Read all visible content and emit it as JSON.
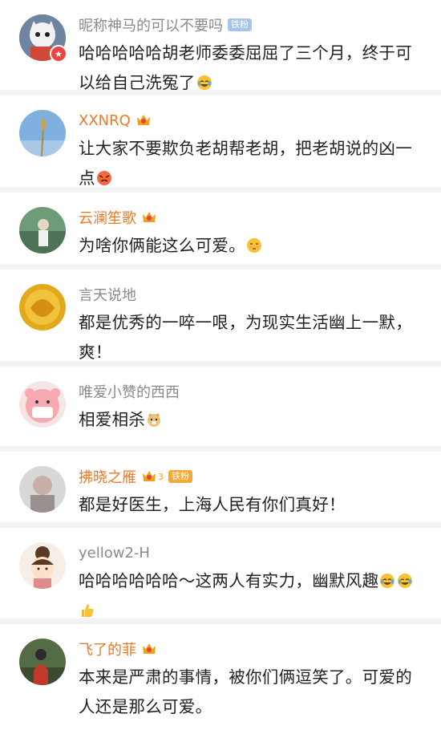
{
  "comments": [
    {
      "name": "昵称神马的可以不要吗",
      "badge": "铁粉",
      "text": "哈哈哈哈哈胡老师委委屈屈了三个月，终于可以给自己洗冤了",
      "emoji_end": "laugh-cry"
    },
    {
      "name": "XXNRQ",
      "text": "让大家不要欺负老胡帮老胡，把老胡说的凶一点",
      "emoji_end": "angry"
    },
    {
      "name": "云澜笙歌",
      "text": "为啥你俩能这么可爱。",
      "emoji_end": "shy"
    },
    {
      "name": "言天说地",
      "text": "都是优秀的一啐一哏，为现实生活幽上一默，爽！"
    },
    {
      "name": "唯爱小赞的西西",
      "text": "相爱相杀",
      "emoji_end": "doge"
    },
    {
      "name": "拂晓之雁",
      "crown_level": "3",
      "badge": "铁粉",
      "text": "都是好医生，上海人民有你们真好！"
    },
    {
      "name": "yellow2-H",
      "text": "哈哈哈哈哈哈～这两人有实力，幽默风趣",
      "emoji_end": "laugh-cry, laugh-cry, thumbs-up"
    },
    {
      "name": "飞了的菲",
      "text": "本来是严肃的事情，被你们俩逗笑了。可爱的人还是那么可爱。"
    }
  ],
  "colors": {
    "vip_name": "#eb7a28",
    "normal_name": "#8a8a8a",
    "text": "#222222",
    "separator": "#f3f3f3"
  },
  "icons": [
    "crown-icon",
    "verified-icon",
    "laugh-cry-emoji",
    "angry-emoji",
    "shy-emoji",
    "doge-emoji",
    "thumbs-up-emoji"
  ]
}
